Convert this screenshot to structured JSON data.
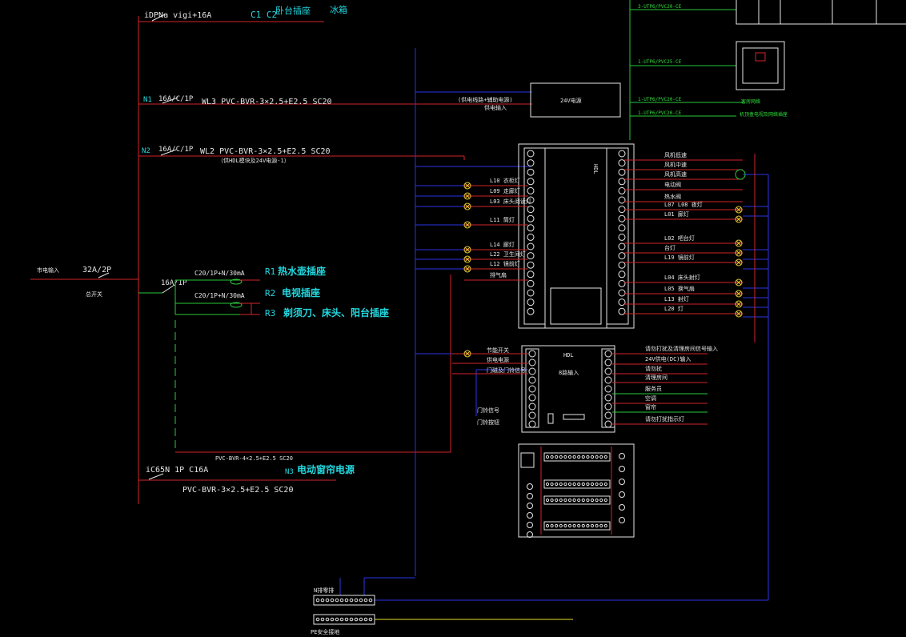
{
  "left_panel": {
    "main_input": "市电输入",
    "main_breaker": "32A/2P",
    "main_breaker_name": "总开关",
    "branch_top": {
      "breaker": "iDPNa  vigi+16A",
      "circuit": "C1 C2",
      "label": "卧台插座",
      "extra": "冰箱"
    },
    "branch_n1": {
      "tag": "N1",
      "breaker": "16A/C/1P",
      "cable": "WL3  PVC-BVR-3×2.5+E2.5  SC20"
    },
    "branch_n2": {
      "tag": "N2",
      "breaker": "16A/C/1P",
      "cable": "WL2  PVC-BVR-3×2.5+E2.5  SC20",
      "note": "（供HDL模块及24V电源-1）"
    },
    "rcd_group": {
      "main": "16A/1P",
      "rcd1": "C20/1P+N/30mA",
      "rcd2": "C20/1P+N/30mA",
      "r1": "R1",
      "r1_label": "热水壶插座",
      "r2": "R2",
      "r2_label": "电视插座",
      "r3": "R3",
      "r3_label": "剃须刀、床头、阳台插座",
      "cable": "PVC-BVR-4×2.5+E2.5  SC20"
    },
    "branch_n3": {
      "breaker": "iC65N  1P C16A",
      "tag": "N3",
      "label": "电动窗帘电源",
      "cable": "PVC-BVR-3×2.5+E2.5  SC20"
    }
  },
  "power_supply": {
    "label": "24V电源",
    "in_label_1": "(供电线路+辅助电源)",
    "in_label_2": "供电输入"
  },
  "top_right": {
    "cables": [
      "3-UTP6/PVC20-CE",
      "1-UTP6/PVC25-CE",
      "1-UTP6/PVC20-CE",
      "1-UTP6/PVC20-CE"
    ],
    "cable_notes": [
      "客房网络",
      "机顶盒电视及网络插座"
    ]
  },
  "hdl_module": {
    "brand": "HDL",
    "left_labels": [
      "L10 衣柜灯",
      "L09 走廊灯",
      "L03 床头阅读灯",
      "L11 筒灯",
      "L14 廊灯",
      "L22 卫生间灯",
      "L12 镜前灯",
      "排气扇"
    ],
    "right_labels": [
      "风机低速",
      "风机中速",
      "风机高速",
      "电动阀",
      "热水阀",
      "L07 L08 夜灯",
      "L01 廊灯",
      "L02 吧台灯",
      "台灯",
      "L19 镜前灯",
      "L04 床头射灯",
      "L05 换气扇",
      "L13 射灯",
      "L20 灯"
    ]
  },
  "hdl_module2": {
    "brand": "HDL",
    "subtitle": "8路输入",
    "left_labels": [
      "节能开关",
      "供电电源",
      "门磁及门铃信号",
      "门铃信号",
      "门铃按钮"
    ],
    "right_labels": [
      "请勿打扰及清理房间信号输入",
      "24V供电(DC)输入",
      "请勿扰",
      "清理房间",
      "服务员",
      "空调",
      "窗帘",
      "请勿打扰指示灯"
    ]
  },
  "buses": {
    "n_bus": "N排零排",
    "pe_bus": "PE安全接地"
  }
}
